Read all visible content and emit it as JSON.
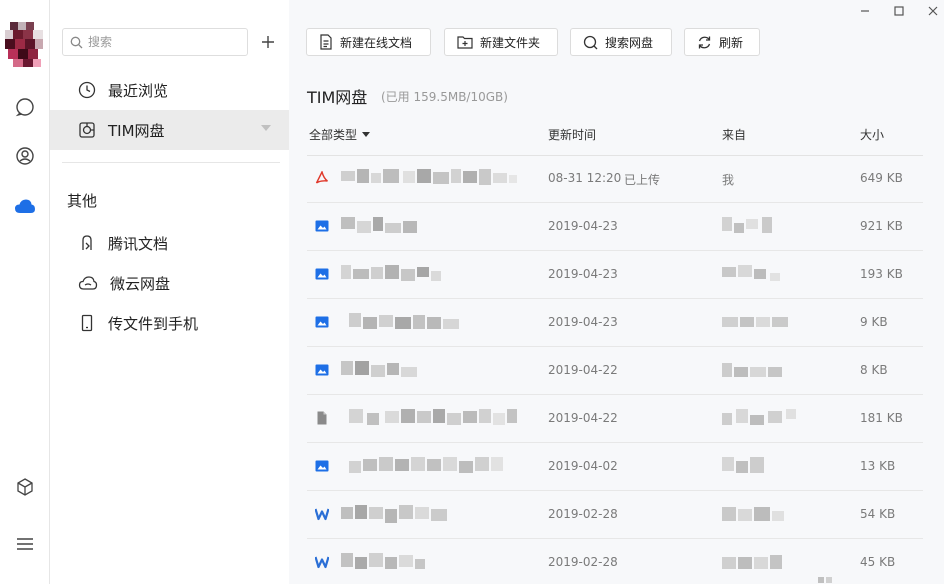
{
  "window": {
    "minimize": "–",
    "maximize": "□",
    "close": "✕"
  },
  "sidebar": {
    "search_placeholder": "搜索",
    "add": "+",
    "items": [
      {
        "label": "最近浏览",
        "icon": "clock-icon"
      },
      {
        "label": "TIM网盘",
        "icon": "netdisk-icon",
        "active": true
      }
    ],
    "section_title": "其他",
    "other_items": [
      {
        "label": "腾讯文档",
        "icon": "tencent-docs-icon"
      },
      {
        "label": "微云网盘",
        "icon": "weiyun-cloud-icon"
      },
      {
        "label": "传文件到手机",
        "icon": "phone-icon"
      }
    ]
  },
  "toolbar": {
    "new_doc": "新建在线文档",
    "new_folder": "新建文件夹",
    "search_disk": "搜索网盘",
    "refresh": "刷新"
  },
  "disk": {
    "title": "TIM网盘",
    "usage": "(已用 159.5MB/10GB)"
  },
  "table": {
    "col_type": "全部类型",
    "col_updated": "更新时间",
    "col_from": "来自",
    "col_size": "大小",
    "rows": [
      {
        "type": "pdf",
        "date": "08-31 12:20",
        "status": "已上传",
        "from": "我",
        "size": "649 KB"
      },
      {
        "type": "image",
        "date": "2019-04-23",
        "status": "",
        "from": "",
        "size": "921 KB"
      },
      {
        "type": "image",
        "date": "2019-04-23",
        "status": "",
        "from": "",
        "size": "193 KB"
      },
      {
        "type": "image",
        "date": "2019-04-23",
        "status": "",
        "from": "",
        "size": "9 KB"
      },
      {
        "type": "image",
        "date": "2019-04-22",
        "status": "",
        "from": "",
        "size": "8 KB"
      },
      {
        "type": "file",
        "date": "2019-04-22",
        "status": "",
        "from": "",
        "size": "181 KB"
      },
      {
        "type": "image",
        "date": "2019-04-02",
        "status": "",
        "from": "",
        "size": "13 KB"
      },
      {
        "type": "word",
        "date": "2019-02-28",
        "status": "",
        "from": "",
        "size": "54 KB"
      },
      {
        "type": "word",
        "date": "2019-02-28",
        "status": "",
        "from": "",
        "size": "45 KB"
      }
    ]
  },
  "colors": {
    "accent": "#1e6fe6",
    "pdf": "#e0392b",
    "word": "#2b6fd6",
    "active_bg": "#ebebeb"
  }
}
